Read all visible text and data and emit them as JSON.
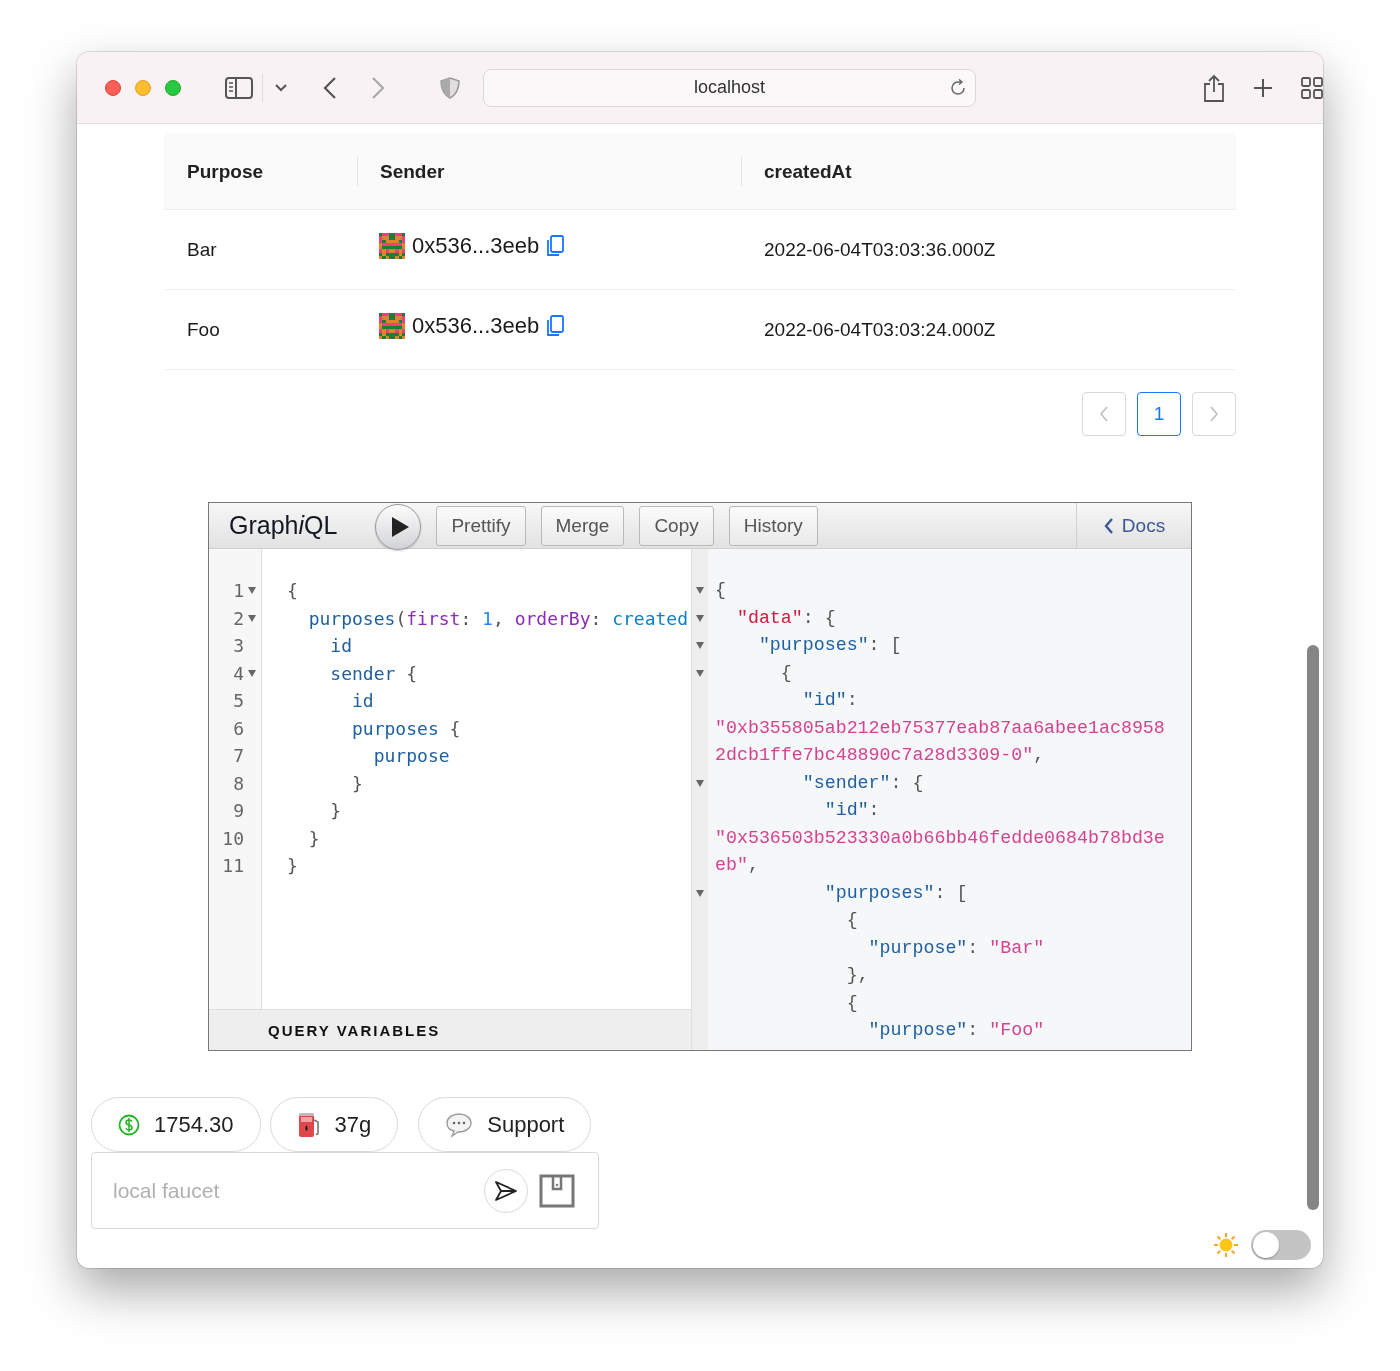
{
  "browser": {
    "address": "localhost"
  },
  "table": {
    "columns": [
      "Purpose",
      "Sender",
      "createdAt"
    ],
    "rows": [
      {
        "purpose": "Bar",
        "sender": "0x536...3eeb",
        "created_at": "2022-06-04T03:03:36.000Z"
      },
      {
        "purpose": "Foo",
        "sender": "0x536...3eeb",
        "created_at": "2022-06-04T03:03:24.000Z"
      }
    ]
  },
  "pagination": {
    "pages": [
      {
        "label": "1",
        "selected": true
      }
    ]
  },
  "graphiql": {
    "title": [
      {
        "text": "Graph",
        "italic": false
      },
      {
        "text": "i",
        "italic": true
      },
      {
        "text": "QL",
        "italic": false
      }
    ],
    "buttons": [
      "Prettify",
      "Merge",
      "Copy",
      "History"
    ],
    "docs": "Docs",
    "query_lines": [
      {
        "number": "1",
        "foldable": true,
        "tokens": [
          {
            "kind": "punct",
            "text": "{"
          }
        ]
      },
      {
        "number": "2",
        "foldable": true,
        "tokens": [
          {
            "kind": "field",
            "text": "  purposes"
          },
          {
            "kind": "punct",
            "text": "("
          },
          {
            "kind": "arg",
            "text": "first"
          },
          {
            "kind": "punct",
            "text": ": "
          },
          {
            "kind": "number",
            "text": "1"
          },
          {
            "kind": "punct",
            "text": ", "
          },
          {
            "kind": "arg",
            "text": "orderBy"
          },
          {
            "kind": "punct",
            "text": ": "
          },
          {
            "kind": "enum",
            "text": "created"
          }
        ]
      },
      {
        "number": "3",
        "foldable": false,
        "tokens": [
          {
            "kind": "field",
            "text": "    id"
          }
        ]
      },
      {
        "number": "4",
        "foldable": true,
        "tokens": [
          {
            "kind": "field",
            "text": "    sender"
          },
          {
            "kind": "punct",
            "text": " {"
          }
        ]
      },
      {
        "number": "5",
        "foldable": false,
        "tokens": [
          {
            "kind": "field",
            "text": "      id"
          }
        ]
      },
      {
        "number": "6",
        "foldable": false,
        "tokens": [
          {
            "kind": "field",
            "text": "      purposes"
          },
          {
            "kind": "punct",
            "text": " {"
          }
        ]
      },
      {
        "number": "7",
        "foldable": false,
        "tokens": [
          {
            "kind": "field",
            "text": "        purpose"
          }
        ]
      },
      {
        "number": "8",
        "foldable": false,
        "tokens": [
          {
            "kind": "punct",
            "text": "      }"
          }
        ]
      },
      {
        "number": "9",
        "foldable": false,
        "tokens": [
          {
            "kind": "punct",
            "text": "    }"
          }
        ]
      },
      {
        "number": "10",
        "foldable": false,
        "tokens": [
          {
            "kind": "punct",
            "text": "  }"
          }
        ]
      },
      {
        "number": "11",
        "foldable": false,
        "tokens": [
          {
            "kind": "punct",
            "text": "}"
          }
        ]
      }
    ],
    "result_lines": [
      {
        "foldable": true,
        "tokens": [
          {
            "kind": "punct",
            "text": "{"
          }
        ]
      },
      {
        "foldable": true,
        "tokens": [
          {
            "kind": "root_key",
            "text": "  \"data\""
          },
          {
            "kind": "punct",
            "text": ": {"
          }
        ]
      },
      {
        "foldable": true,
        "tokens": [
          {
            "kind": "key",
            "text": "    \"purposes\""
          },
          {
            "kind": "punct",
            "text": ": ["
          }
        ]
      },
      {
        "foldable": true,
        "tokens": [
          {
            "kind": "punct",
            "text": "      {"
          }
        ]
      },
      {
        "foldable": false,
        "tokens": [
          {
            "kind": "key",
            "text": "        \"id\""
          },
          {
            "kind": "punct",
            "text": ": "
          },
          {
            "kind": "string",
            "text": "\"0xb355805ab212eb75377eab87aa6abee1ac89582dcb1ffe7bc48890c7a28d3309-0\""
          },
          {
            "kind": "punct",
            "text": ","
          }
        ]
      },
      {
        "foldable": true,
        "tokens": [
          {
            "kind": "key",
            "text": "        \"sender\""
          },
          {
            "kind": "punct",
            "text": ": {"
          }
        ]
      },
      {
        "foldable": false,
        "tokens": [
          {
            "kind": "key",
            "text": "          \"id\""
          },
          {
            "kind": "punct",
            "text": ": "
          },
          {
            "kind": "string",
            "text": "\"0x536503b523330a0b66bb46fedde0684b78bd3eeb\""
          },
          {
            "kind": "punct",
            "text": ","
          }
        ]
      },
      {
        "foldable": true,
        "tokens": [
          {
            "kind": "key",
            "text": "          \"purposes\""
          },
          {
            "kind": "punct",
            "text": ": ["
          }
        ]
      },
      {
        "foldable": false,
        "tokens": [
          {
            "kind": "punct",
            "text": "            {"
          }
        ]
      },
      {
        "foldable": false,
        "tokens": [
          {
            "kind": "key",
            "text": "              \"purpose\""
          },
          {
            "kind": "punct",
            "text": ": "
          },
          {
            "kind": "string",
            "text": "\"Bar\""
          }
        ]
      },
      {
        "foldable": false,
        "tokens": [
          {
            "kind": "punct",
            "text": "            },"
          }
        ]
      },
      {
        "foldable": false,
        "tokens": [
          {
            "kind": "punct",
            "text": "            {"
          }
        ]
      },
      {
        "foldable": false,
        "tokens": [
          {
            "kind": "key",
            "text": "              \"purpose\""
          },
          {
            "kind": "punct",
            "text": ": "
          },
          {
            "kind": "string",
            "text": "\"Foo\""
          }
        ]
      }
    ],
    "variables_label": "QUERY VARIABLES"
  },
  "wallet": {
    "balance": "1754.30",
    "gas": "37g",
    "support": "Support",
    "faucet_placeholder": "local faucet"
  },
  "theme_toggle": {
    "on": false
  }
}
